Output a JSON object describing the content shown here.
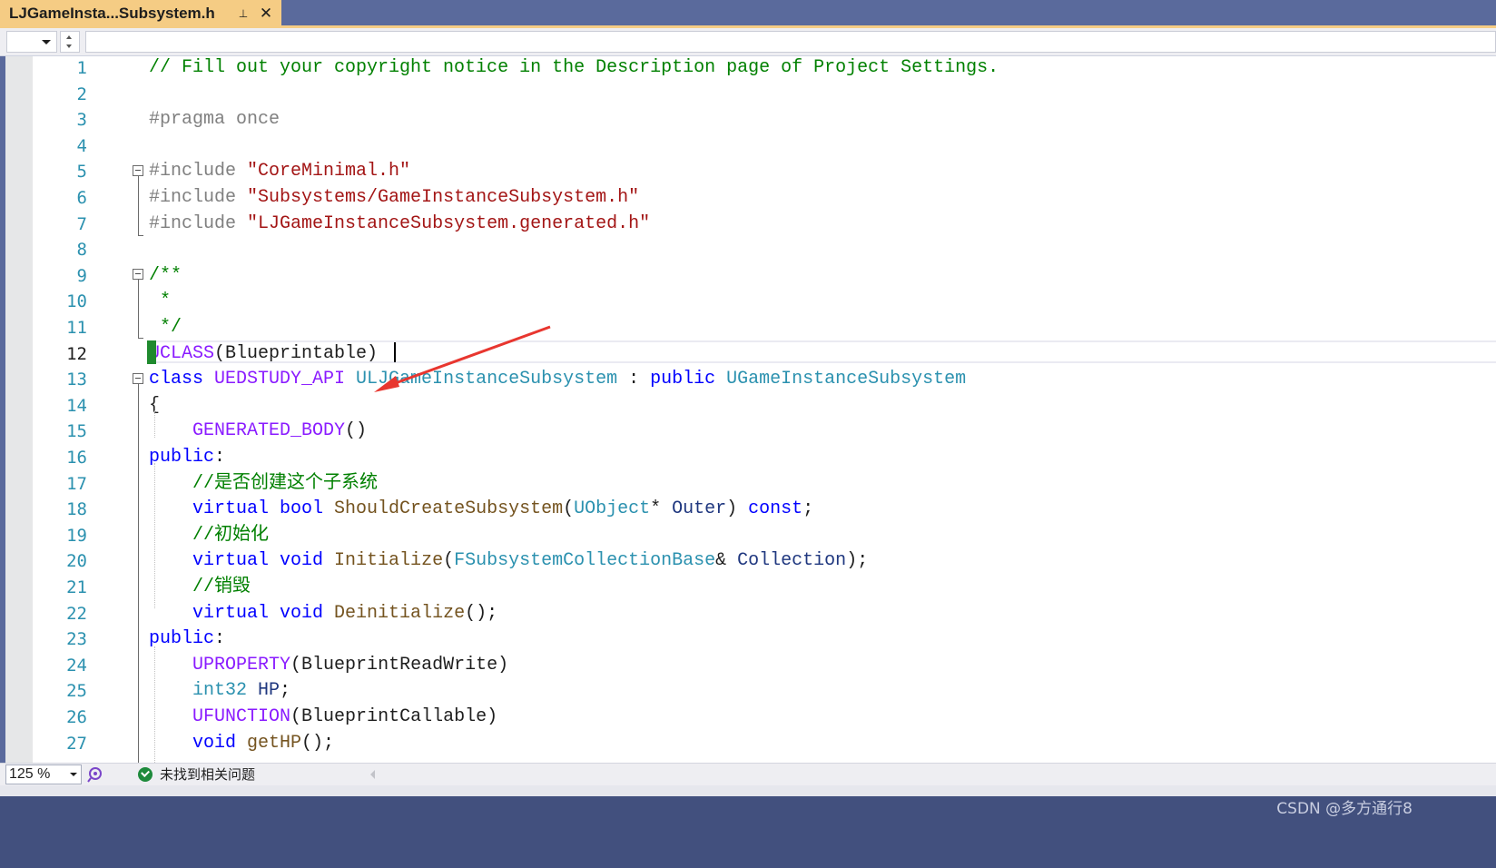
{
  "tab": {
    "title": "LJGameInsta...Subsystem.h",
    "pin_glyph": "⊥",
    "close_glyph": "✕"
  },
  "editor": {
    "zoom": "125 %",
    "current_line": 12,
    "lines": [
      {
        "n": "1",
        "parts": [
          {
            "t": "// Fill out your copyright notice in the Description page of Project Settings.",
            "c": "comment"
          }
        ]
      },
      {
        "n": "2",
        "parts": []
      },
      {
        "n": "3",
        "parts": [
          {
            "t": "#pragma once",
            "c": "pre"
          }
        ]
      },
      {
        "n": "4",
        "parts": []
      },
      {
        "n": "5",
        "parts": [
          {
            "t": "#include ",
            "c": "pre"
          },
          {
            "t": "\"CoreMinimal.h\"",
            "c": "string"
          }
        ]
      },
      {
        "n": "6",
        "parts": [
          {
            "t": "#include ",
            "c": "pre"
          },
          {
            "t": "\"Subsystems/GameInstanceSubsystem.h\"",
            "c": "string"
          }
        ]
      },
      {
        "n": "7",
        "parts": [
          {
            "t": "#include ",
            "c": "pre"
          },
          {
            "t": "\"LJGameInstanceSubsystem.generated.h\"",
            "c": "string"
          }
        ]
      },
      {
        "n": "8",
        "parts": []
      },
      {
        "n": "9",
        "parts": [
          {
            "t": "/**",
            "c": "comment"
          }
        ]
      },
      {
        "n": "10",
        "parts": [
          {
            "t": " *",
            "c": "comment"
          }
        ]
      },
      {
        "n": "11",
        "parts": [
          {
            "t": " */",
            "c": "comment"
          }
        ]
      },
      {
        "n": "12",
        "parts": [
          {
            "t": "UCLASS",
            "c": "macro"
          },
          {
            "t": "(Blueprintable)",
            "c": "plain"
          }
        ]
      },
      {
        "n": "13",
        "parts": [
          {
            "t": "class ",
            "c": "kw"
          },
          {
            "t": "UEDSTUDY_API ",
            "c": "macro"
          },
          {
            "t": "ULJGameInstanceSubsystem",
            "c": "type"
          },
          {
            "t": " : ",
            "c": "plain"
          },
          {
            "t": "public ",
            "c": "kw"
          },
          {
            "t": "UGameInstanceSubsystem",
            "c": "type"
          }
        ]
      },
      {
        "n": "14",
        "parts": [
          {
            "t": "{",
            "c": "plain"
          }
        ]
      },
      {
        "n": "15",
        "parts": [
          {
            "t": "    ",
            "c": "plain"
          },
          {
            "t": "GENERATED_BODY",
            "c": "macro"
          },
          {
            "t": "()",
            "c": "plain"
          }
        ]
      },
      {
        "n": "16",
        "parts": [
          {
            "t": "public",
            "c": "kw"
          },
          {
            "t": ":",
            "c": "plain"
          }
        ]
      },
      {
        "n": "17",
        "parts": [
          {
            "t": "    ",
            "c": "plain"
          },
          {
            "t": "//是否创建这个子系统",
            "c": "comment"
          }
        ]
      },
      {
        "n": "18",
        "parts": [
          {
            "t": "    ",
            "c": "plain"
          },
          {
            "t": "virtual ",
            "c": "kw"
          },
          {
            "t": "bool ",
            "c": "kw"
          },
          {
            "t": "ShouldCreateSubsystem",
            "c": "func"
          },
          {
            "t": "(",
            "c": "plain"
          },
          {
            "t": "UObject",
            "c": "type"
          },
          {
            "t": "* ",
            "c": "plain"
          },
          {
            "t": "Outer",
            "c": "param"
          },
          {
            "t": ") ",
            "c": "plain"
          },
          {
            "t": "const",
            "c": "kw"
          },
          {
            "t": ";",
            "c": "plain"
          }
        ]
      },
      {
        "n": "19",
        "parts": [
          {
            "t": "    ",
            "c": "plain"
          },
          {
            "t": "//初始化",
            "c": "comment"
          }
        ]
      },
      {
        "n": "20",
        "parts": [
          {
            "t": "    ",
            "c": "plain"
          },
          {
            "t": "virtual ",
            "c": "kw"
          },
          {
            "t": "void ",
            "c": "kw"
          },
          {
            "t": "Initialize",
            "c": "func"
          },
          {
            "t": "(",
            "c": "plain"
          },
          {
            "t": "FSubsystemCollectionBase",
            "c": "type"
          },
          {
            "t": "& ",
            "c": "plain"
          },
          {
            "t": "Collection",
            "c": "param"
          },
          {
            "t": ");",
            "c": "plain"
          }
        ]
      },
      {
        "n": "21",
        "parts": [
          {
            "t": "    ",
            "c": "plain"
          },
          {
            "t": "//销毁",
            "c": "comment"
          }
        ]
      },
      {
        "n": "22",
        "parts": [
          {
            "t": "    ",
            "c": "plain"
          },
          {
            "t": "virtual ",
            "c": "kw"
          },
          {
            "t": "void ",
            "c": "kw"
          },
          {
            "t": "Deinitialize",
            "c": "func"
          },
          {
            "t": "();",
            "c": "plain"
          }
        ]
      },
      {
        "n": "23",
        "parts": [
          {
            "t": "public",
            "c": "kw"
          },
          {
            "t": ":",
            "c": "plain"
          }
        ]
      },
      {
        "n": "24",
        "parts": [
          {
            "t": "    ",
            "c": "plain"
          },
          {
            "t": "UPROPERTY",
            "c": "macro"
          },
          {
            "t": "(BlueprintReadWrite)",
            "c": "plain"
          }
        ]
      },
      {
        "n": "25",
        "parts": [
          {
            "t": "    ",
            "c": "plain"
          },
          {
            "t": "int32 ",
            "c": "type"
          },
          {
            "t": "HP",
            "c": "param"
          },
          {
            "t": ";",
            "c": "plain"
          }
        ]
      },
      {
        "n": "26",
        "parts": [
          {
            "t": "    ",
            "c": "plain"
          },
          {
            "t": "UFUNCTION",
            "c": "macro"
          },
          {
            "t": "(BlueprintCallable)",
            "c": "plain"
          }
        ]
      },
      {
        "n": "27",
        "parts": [
          {
            "t": "    ",
            "c": "plain"
          },
          {
            "t": "void ",
            "c": "kw"
          },
          {
            "t": "getHP",
            "c": "func"
          },
          {
            "t": "();",
            "c": "plain"
          }
        ]
      }
    ]
  },
  "status": {
    "issues": "未找到相关问题"
  },
  "watermark": "CSDN @多方通行8",
  "colors": {
    "tab_active": "#f5cc84",
    "chrome": "#5a6a9c",
    "change_marker": "#1f8a2e",
    "annotation_arrow": "#e8362f"
  }
}
